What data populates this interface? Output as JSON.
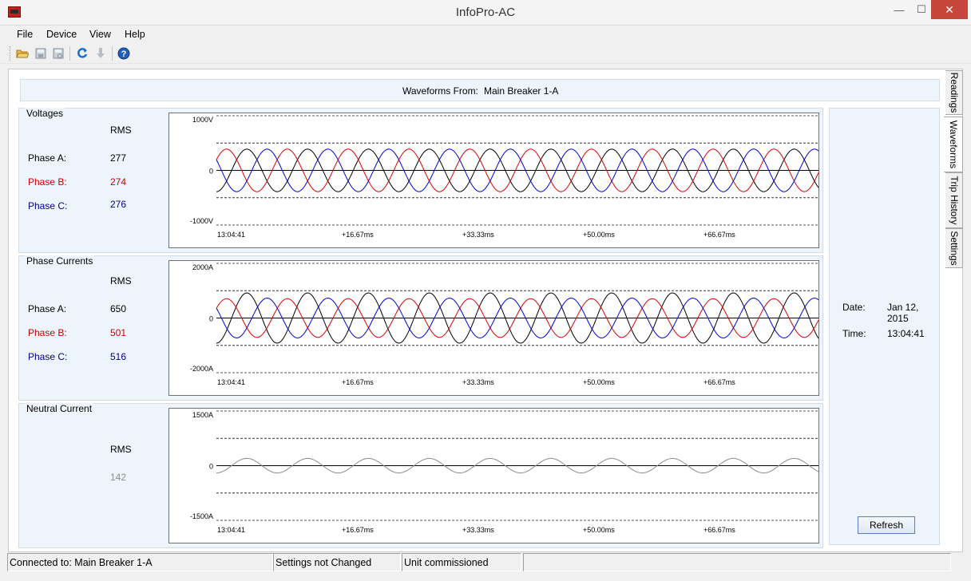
{
  "window": {
    "title": "InfoPro-AC",
    "min_symbol": "—",
    "max_symbol": "☐",
    "close_symbol": "✕"
  },
  "menu": [
    "File",
    "Device",
    "View",
    "Help"
  ],
  "toolbar": [
    "open-folder-icon",
    "save-icon",
    "save-as-icon",
    "refresh-icon",
    "download-icon",
    "help-icon"
  ],
  "header": {
    "label": "Waveforms From:",
    "value": "Main Breaker 1-A"
  },
  "x_ticks": [
    "13:04:41",
    "+16.67ms",
    "+33.33ms",
    "+50.00ms",
    "+66.67ms"
  ],
  "voltages": {
    "title": "Voltages",
    "rms": "RMS",
    "phases": [
      {
        "label": "Phase A:",
        "value": "277",
        "color": "#000000"
      },
      {
        "label": "Phase B:",
        "value": "274",
        "color": "#cc0000"
      },
      {
        "label": "Phase C:",
        "value": "276",
        "color": "#00008b"
      }
    ],
    "y_labels": {
      "top": "1000V",
      "zero": "0",
      "bottom": "-1000V"
    }
  },
  "currents": {
    "title": "Phase Currents",
    "rms": "RMS",
    "phases": [
      {
        "label": "Phase A:",
        "value": "650",
        "color": "#000000"
      },
      {
        "label": "Phase B:",
        "value": "501",
        "color": "#cc0000"
      },
      {
        "label": "Phase C:",
        "value": "516",
        "color": "#00008b"
      }
    ],
    "y_labels": {
      "top": "2000A",
      "zero": "0",
      "bottom": "-2000A"
    }
  },
  "neutral": {
    "title": "Neutral Current",
    "rms": "RMS",
    "value": "142",
    "y_labels": {
      "top": "1500A",
      "zero": "0",
      "bottom": "-1500A"
    }
  },
  "colors": {
    "phase_a": "#000000",
    "phase_b": "#e00000",
    "phase_c": "#0000e0",
    "neutral": "#8c8c8c"
  },
  "chart_data": [
    {
      "type": "line",
      "title": "Voltages",
      "ylim": [
        -1000,
        1000
      ],
      "x_ticks": [
        "13:04:41",
        "+16.67ms",
        "+33.33ms",
        "+50.00ms",
        "+66.67ms"
      ],
      "series": [
        {
          "name": "Phase A",
          "amplitude": 390,
          "phase_deg": -90,
          "color": "#000000"
        },
        {
          "name": "Phase B",
          "amplitude": 390,
          "phase_deg": 30,
          "color": "#e00000"
        },
        {
          "name": "Phase C",
          "amplitude": 390,
          "phase_deg": 150,
          "color": "#0000e0"
        }
      ]
    },
    {
      "type": "line",
      "title": "Phase Currents",
      "ylim": [
        -2000,
        2000
      ],
      "x_ticks": [
        "13:04:41",
        "+16.67ms",
        "+33.33ms",
        "+50.00ms",
        "+66.67ms"
      ],
      "series": [
        {
          "name": "Phase A",
          "amplitude": 920,
          "phase_deg": -90,
          "color": "#000000"
        },
        {
          "name": "Phase B",
          "amplitude": 710,
          "phase_deg": 30,
          "color": "#e00000"
        },
        {
          "name": "Phase C",
          "amplitude": 730,
          "phase_deg": 150,
          "color": "#0000e0"
        }
      ]
    },
    {
      "type": "line",
      "title": "Neutral Current",
      "ylim": [
        -1500,
        1500
      ],
      "x_ticks": [
        "13:04:41",
        "+16.67ms",
        "+33.33ms",
        "+50.00ms",
        "+66.67ms"
      ],
      "series": [
        {
          "name": "Neutral",
          "amplitude": 200,
          "phase_deg": -90,
          "color": "#8c8c8c"
        }
      ]
    }
  ],
  "side": {
    "date_label": "Date:",
    "date_value": "Jan 12, 2015",
    "time_label": "Time:",
    "time_value": "13:04:41",
    "refresh": "Refresh"
  },
  "tabs": [
    "Readings",
    "Waveforms",
    "Trip History",
    "Settings"
  ],
  "status": [
    "Connected to: Main Breaker 1-A",
    "Settings not Changed",
    "Unit commissioned",
    ""
  ]
}
